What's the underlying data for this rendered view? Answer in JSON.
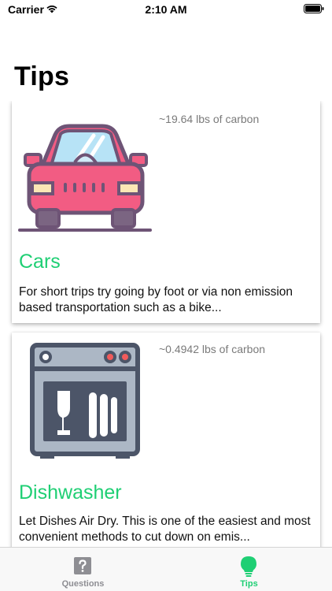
{
  "status_bar": {
    "carrier": "Carrier",
    "time": "2:10 AM"
  },
  "page": {
    "title": "Tips"
  },
  "tips": [
    {
      "carbon": "~19.64 lbs of carbon",
      "title": "Cars",
      "description": "For short trips try going by foot or via non emission based transportation such as a bike...",
      "icon": "car-icon"
    },
    {
      "carbon": "~0.4942 lbs of carbon",
      "title": "Dishwasher",
      "description": "Let Dishes Air Dry. This is one of the easiest and most convenient methods to cut down on emis...",
      "icon": "dishwasher-icon"
    }
  ],
  "tab_bar": {
    "items": [
      {
        "label": "Questions",
        "icon": "question-icon",
        "selected": false
      },
      {
        "label": "Tips",
        "icon": "lightbulb-icon",
        "selected": true
      }
    ],
    "active_color": "#1fcf74",
    "inactive_color": "#8e8e93"
  },
  "colors": {
    "accent": "#1fcf74"
  }
}
